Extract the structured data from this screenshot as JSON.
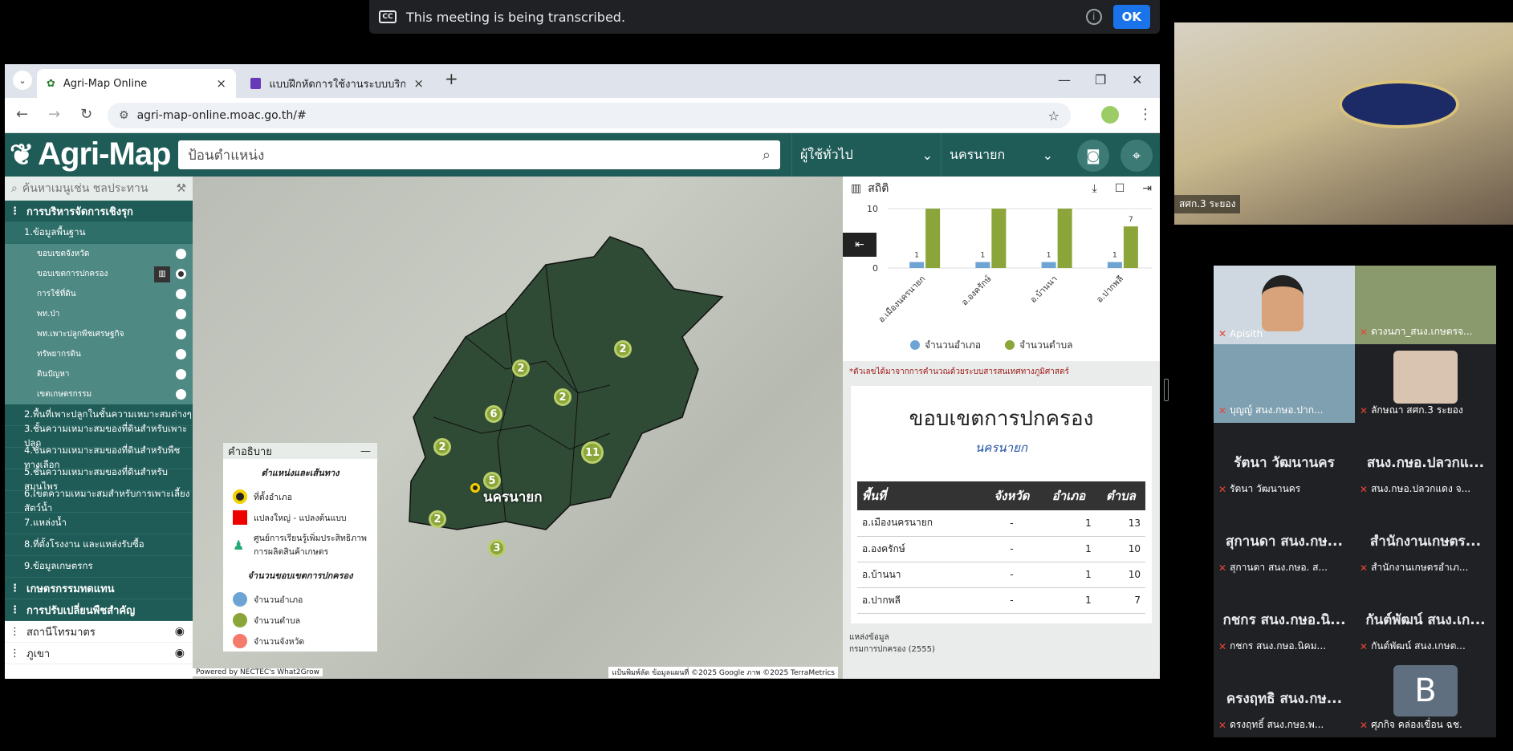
{
  "banner": {
    "cc_label": "CC",
    "text": "This meeting is being transcribed.",
    "info": "i",
    "ok": "OK"
  },
  "browser": {
    "tabs": [
      {
        "label": "Agri-Map Online",
        "close": "×"
      },
      {
        "label": "แบบฝึกหัดการใช้งานระบบบริการข้อมู",
        "close": "×"
      }
    ],
    "new_tab": "+",
    "url": "agri-map-online.moac.go.th/#"
  },
  "app": {
    "logo": "Agri-Map",
    "search_placeholder": "ป้อนตำแหน่ง",
    "user_type": "ผู้ใช้ทั่วไป",
    "province": "นครนายก"
  },
  "sidebar": {
    "search_placeholder": "ค้นหาเมนูเช่น ชลประทาน",
    "group_main": "การบริหารจัดการเชิงรุก",
    "sub_basic": "1.ข้อมูลพื้นฐาน",
    "leaves": [
      "ขอบเขตจังหวัด",
      "ขอบเขตการปกครอง",
      "การใช้ที่ดิน",
      "พท.ป่า",
      "พท.เพาะปลูกพืชเศรษฐกิจ",
      "ทรัพยากรดิน",
      "ดินปัญหา",
      "เขตเกษตรกรรม"
    ],
    "subs": [
      "2.พื้นที่เพาะปลูกในชั้นความเหมาะสมต่างๆ",
      "3.ชั้นความเหมาะสมของที่ดินสำหรับเพาะปลูก",
      "4.ชั้นความเหมาะสมของที่ดินสำหรับพืชทางเลือก",
      "5.ชั้นความเหมาะสมของที่ดินสำหรับสมุนไพร",
      "6.เขตความเหมาะสมสำหรับการเพาะเลี้ยงสัตว์น้ำ",
      "7.แหล่งน้ำ",
      "8.ที่ตั้งโรงงาน และแหล่งรับซื้อ",
      "9.ข้อมูลเกษตรกร"
    ],
    "group2": "เกษตรกรรมทดแทน",
    "group3": "การปรับเปลี่ยนพืชสำคัญ",
    "station": "สถานีโทรมาตร",
    "station2": "ภูเขา"
  },
  "map": {
    "place_label": "นครนายก",
    "legend": {
      "title": "คำอธิบาย",
      "section1": "ตำแหน่งและเส้นทาง",
      "items1": [
        "ที่ตั้งอำเภอ",
        "แปลงใหญ่ - แปลงต้นแบบ",
        "ศูนย์การเรียนรู้เพิ่มประสิทธิภาพการผลิตสินค้าเกษตร"
      ],
      "section2": "จำนวนขอบเขตการปกครอง",
      "items2": [
        "จำนวนอำเภอ",
        "จำนวนตำบล",
        "จำนวนจังหวัด"
      ],
      "colors2": [
        "#6ea4d4",
        "#8ba53a",
        "#f47a6b"
      ]
    },
    "clusters": [
      2,
      2,
      2,
      6,
      2,
      11,
      5,
      2,
      3
    ],
    "footer_left": "Powered by NECTEC's What2Grow",
    "footer_right": "แป้นพิมพ์ลัด   ข้อมูลแผนที่ ©2025 Google ภาพ ©2025 TerraMetrics"
  },
  "stats": {
    "title": "สถิติ",
    "note": "*ตัวเลขได้มาจากการคำนวณด้วยระบบสารสนเทศทางภูมิศาสตร์",
    "card_title": "ขอบเขตการปกครอง",
    "card_subtitle": "นครนายก",
    "table": {
      "headers": [
        "พื้นที่",
        "จังหวัด",
        "อำเภอ",
        "ตำบล"
      ],
      "rows": [
        [
          "อ.เมืองนครนายก",
          "-",
          "1",
          "13"
        ],
        [
          "อ.องครักษ์",
          "-",
          "1",
          "10"
        ],
        [
          "อ.บ้านนา",
          "-",
          "1",
          "10"
        ],
        [
          "อ.ปากพลี",
          "-",
          "1",
          "7"
        ]
      ]
    },
    "datasrc1": "แหล่งข้อมูล",
    "datasrc2": "กรมการปกครอง (2555)"
  },
  "chart_data": {
    "type": "bar",
    "categories": [
      "อ.เมืองนครนายก",
      "อ.องครักษ์",
      "อ.บ้านนา",
      "อ.ปากพลี"
    ],
    "series": [
      {
        "name": "จำนวนอำเภอ",
        "values": [
          1,
          1,
          1,
          1
        ],
        "color": "#6ea4d4"
      },
      {
        "name": "จำนวนตำบล",
        "values": [
          13,
          10,
          10,
          7
        ],
        "color": "#8ba53a"
      }
    ],
    "yticks": [
      "0",
      "10"
    ],
    "ylim": [
      0,
      10
    ],
    "data_labels": [
      "1",
      "1",
      "1",
      "1",
      "7"
    ],
    "legend_position": "bottom"
  },
  "meeting": {
    "main_caption": "สศก.3 ระยอง",
    "tiles": [
      {
        "name": "",
        "caption": "Apisith"
      },
      {
        "name": "",
        "caption": "ดวงนภา_สนง.เกษตรจ..."
      },
      {
        "name": "",
        "caption": "บุญญ์ สนง.กษอ.ปาก..."
      },
      {
        "name": "",
        "caption": "ลักษณา สศก.3 ระยอง"
      },
      {
        "name": "รัตนา วัฒนานคร",
        "caption": "รัตนา วัฒนานคร"
      },
      {
        "name": "สนง.กษอ.ปลวกแ...",
        "caption": "สนง.กษอ.ปลวกแดง จ..."
      },
      {
        "name": "สุกานดา สนง.กษ...",
        "caption": "สุกานดา สนง.กษอ. ส..."
      },
      {
        "name": "สำนักงานเกษตร...",
        "caption": "สำนักงานเกษตรอำเภ..."
      },
      {
        "name": "กชกร สนง.กษอ.นิ...",
        "caption": "กชกร สนง.กษอ.นิคม..."
      },
      {
        "name": "กันต์พัฒน์ สนง.เก...",
        "caption": "กันต์พัฒน์ สนง.เกษต..."
      },
      {
        "name": "ครงฤทธิ สนง.กษ...",
        "caption": "ดรงฤทธิ์ สนง.กษอ.พ..."
      },
      {
        "name": "B",
        "caption": "ศุภกิจ คล่องเขื่อน ฉช."
      }
    ]
  }
}
